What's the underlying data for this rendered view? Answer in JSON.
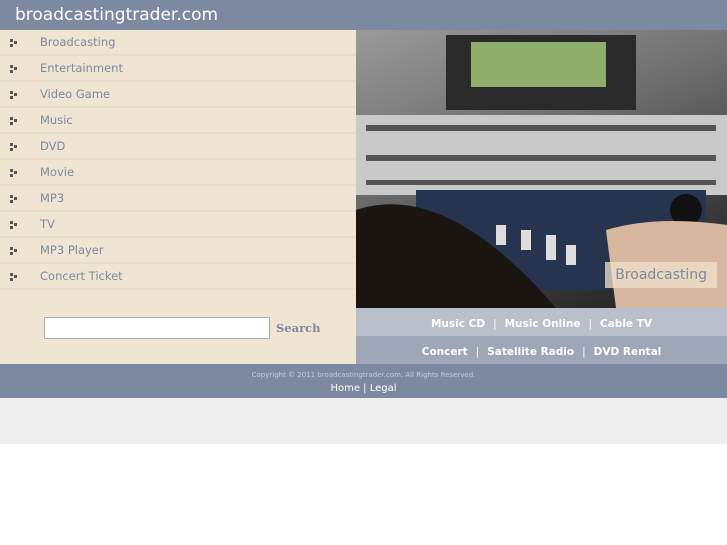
{
  "header": {
    "title": "broadcastingtrader.com"
  },
  "nav": {
    "items": [
      {
        "label": "Broadcasting"
      },
      {
        "label": "Entertainment"
      },
      {
        "label": "Video Game"
      },
      {
        "label": "Music"
      },
      {
        "label": "DVD"
      },
      {
        "label": "Movie"
      },
      {
        "label": "MP3"
      },
      {
        "label": "TV"
      },
      {
        "label": "MP3 Player"
      },
      {
        "label": "Concert Ticket"
      }
    ]
  },
  "search": {
    "value": "",
    "button": "Search"
  },
  "hero": {
    "caption": "Broadcasting"
  },
  "links_row1": [
    "Music CD",
    "Music Online",
    "Cable TV"
  ],
  "links_row2": [
    "Concert",
    "Satellite Radio",
    "DVD Rental"
  ],
  "footer": {
    "copyright": "Copyright © 2011 broadcastingtrader.com. All Rights Reserved.",
    "home": "Home",
    "legal": "Legal"
  },
  "colors": {
    "header": "#7d89a1",
    "sidebar": "#efe5d2",
    "link_bar_1": "#b9c0cc",
    "link_bar_2": "#9ea7b8"
  }
}
